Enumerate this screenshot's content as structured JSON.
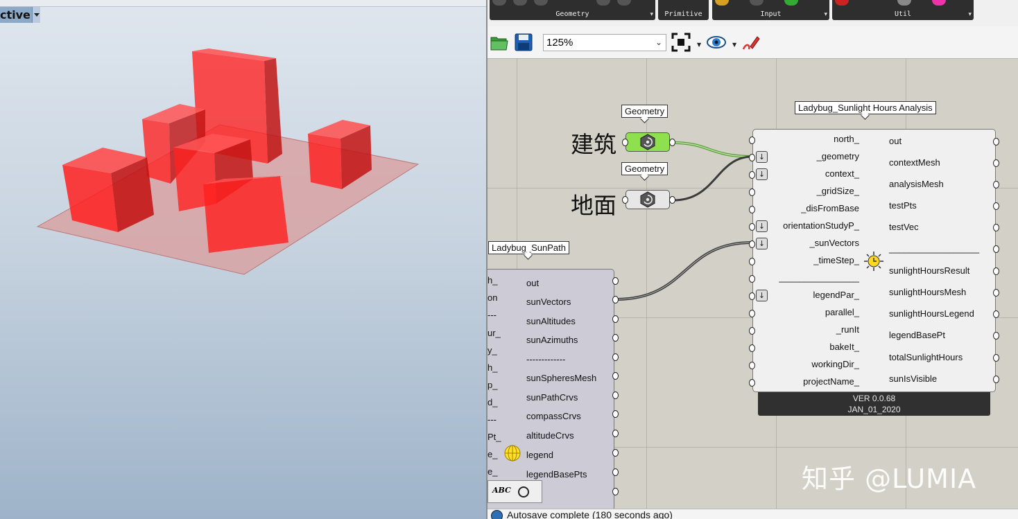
{
  "viewport": {
    "tab_label": "ctive"
  },
  "ribbon": {
    "groups": [
      "Geometry",
      "Primitive",
      "Input",
      "Util"
    ]
  },
  "toolbar": {
    "zoom_value": "125%"
  },
  "canvas": {
    "label_jianzhu": "建筑",
    "label_dimian": "地面",
    "geometry_tag_1": "Geometry",
    "geometry_tag_2": "Geometry",
    "sunlight_title": "Ladybug_Sunlight Hours Analysis",
    "sunpath_title": "Ladybug_SunPath",
    "sunlight_inputs": [
      "north_",
      "_geometry",
      "context_",
      "_gridSize_",
      "_disFromBase",
      "orientationStudyP_",
      "_sunVectors",
      "_timeStep_",
      "________________",
      "legendPar_",
      "parallel_",
      "_runIt",
      "bakeIt_",
      "workingDir_",
      "projectName_"
    ],
    "sunlight_outputs": [
      "out",
      "contextMesh",
      "analysisMesh",
      "testPts",
      "testVec",
      "__________________",
      "sunlightHoursResult",
      "sunlightHoursMesh",
      "sunlightHoursLegend",
      "legendBasePt",
      "totalSunlightHours",
      "sunIsVisible"
    ],
    "sunlight_version": "VER 0.0.68",
    "sunlight_date": "JAN_01_2020",
    "sunpath_inputs": [
      "h_",
      "on",
      "---",
      "ur_",
      "y_",
      "h_",
      "p_",
      "d_",
      "---",
      "Pt_",
      "e_",
      "e_"
    ],
    "sunpath_outputs": [
      "out",
      "sunVectors",
      "sunAltitudes",
      "sunAzimuths",
      "-------------",
      "sunSpheresMesh",
      "sunPathCrvs",
      "compassCrvs",
      "altitudeCrvs",
      "legend",
      "legendBasePts"
    ],
    "abc_label": "ABC",
    "watermark": "知乎 @LUMIA"
  },
  "status": {
    "text": "Autosave complete (180 seconds ago)"
  },
  "colors": {
    "building_red": "#ff1a1a",
    "ground_pink": "#d9a3a3",
    "param_green": "#8ee04f",
    "canvas_bg": "#d3d0c8"
  }
}
